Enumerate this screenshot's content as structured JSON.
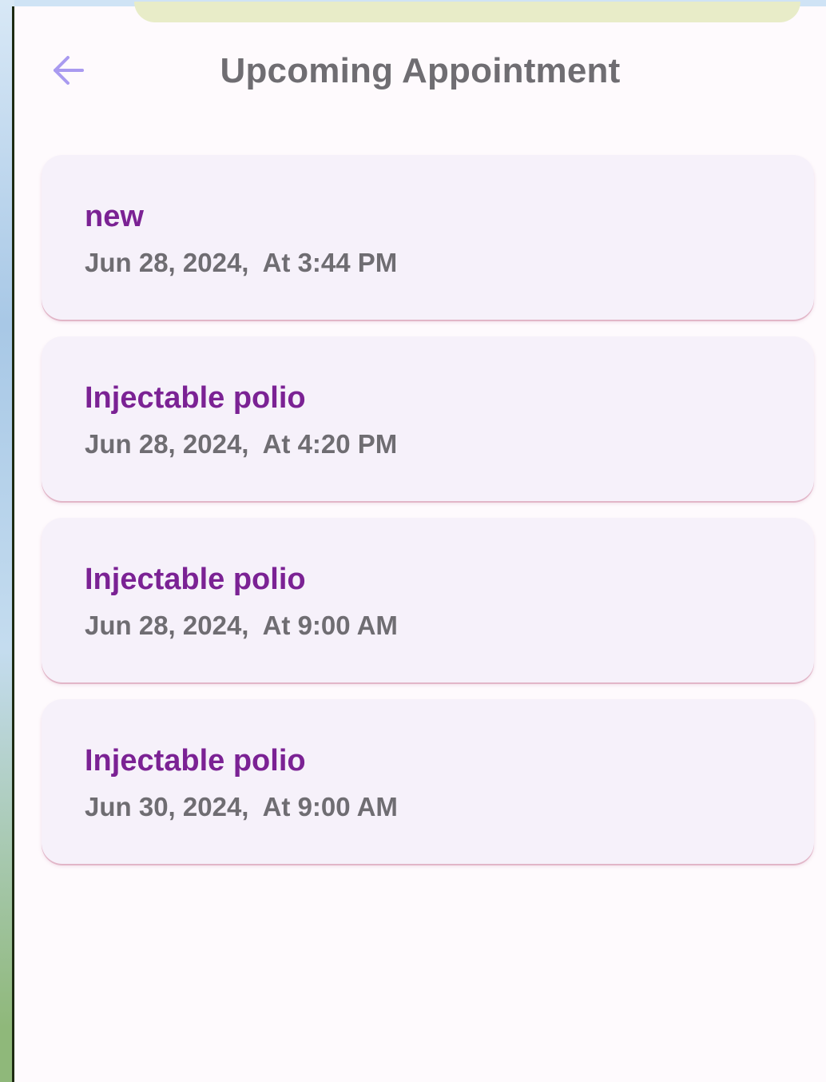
{
  "header": {
    "title": "Upcoming Appointment",
    "back_icon": "arrow-left-icon"
  },
  "colors": {
    "accent": "#7b2294",
    "title_text": "#6f6d72",
    "back_icon": "#a99af0",
    "card_background": "#f6f1fa",
    "page_background": "#fefafd"
  },
  "appointments": [
    {
      "title": "new",
      "date": "Jun 28, 2024,",
      "time": "At 3:44 PM"
    },
    {
      "title": "Injectable polio",
      "date": "Jun 28, 2024,",
      "time": "At 4:20 PM"
    },
    {
      "title": "Injectable polio",
      "date": "Jun 28, 2024,",
      "time": "At 9:00 AM"
    },
    {
      "title": "Injectable polio",
      "date": "Jun 30, 2024,",
      "time": "At 9:00 AM"
    }
  ]
}
